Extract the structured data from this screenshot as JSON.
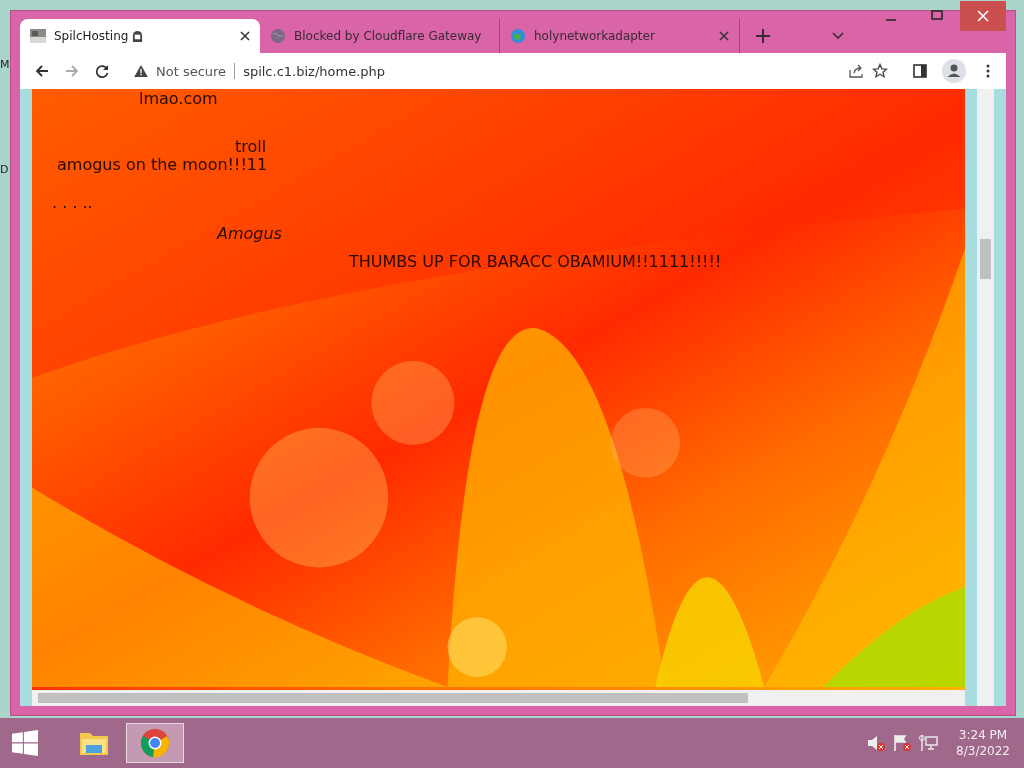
{
  "desktop": {
    "icon_labels": [
      "M",
      "D"
    ]
  },
  "browser": {
    "tabs": [
      {
        "title": "SpilcHosting",
        "kind": "photo",
        "selected": true
      },
      {
        "title": "Blocked by Cloudflare Gateway",
        "kind": "grey-globe",
        "selected": false
      },
      {
        "title": "holynetworkadapter",
        "kind": "globe",
        "selected": false
      }
    ],
    "address": {
      "security": "Not secure",
      "url": "spilc.c1.biz/home.php"
    }
  },
  "page": {
    "texts": [
      {
        "text": "lmao.com",
        "italic": false
      },
      {
        "text": "troll",
        "italic": false
      },
      {
        "text": "amogus on the moon!!!11",
        "italic": false
      },
      {
        "text": ". . . ..",
        "italic": false
      },
      {
        "text": "Amogus",
        "italic": true
      },
      {
        "text": "THUMBS UP FOR BARACC OBAMIUM!!1111!!!!!",
        "italic": false
      }
    ]
  },
  "taskbar": {
    "apps": [
      {
        "kind": "folder",
        "selected": false
      },
      {
        "kind": "chrome",
        "selected": true
      }
    ],
    "clock": {
      "time": "3:24 PM",
      "date": "8/3/2022"
    }
  }
}
